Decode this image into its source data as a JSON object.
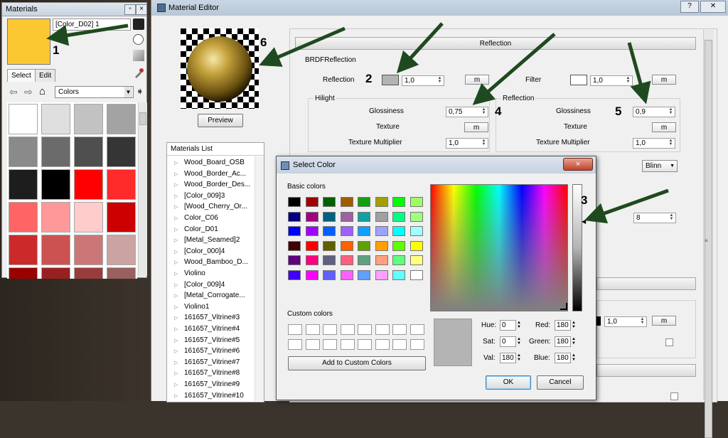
{
  "materials_panel": {
    "title": "Materials",
    "material_name": "[Color_D02] 1",
    "swatch_color": "#fcc831",
    "tabs": [
      "Select",
      "Edit"
    ],
    "library": "Colors",
    "colors": [
      "#ffffff",
      "#dfdfdf",
      "#c2c2c2",
      "#a3a3a3",
      "#8a8a8a",
      "#6b6b6b",
      "#4f4f4f",
      "#353535",
      "#1d1d1d",
      "#000000",
      "#ff0000",
      "#ff2a2a",
      "#ff6565",
      "#ff9999",
      "#ffcccc",
      "#cc0000",
      "#cc2a2a",
      "#cc5151",
      "#cc7777",
      "#cca3a3",
      "#990000",
      "#992020",
      "#993c3c",
      "#996060"
    ]
  },
  "editor": {
    "title": "Material Editor",
    "preview_button": "Preview",
    "reflection_section": "Reflection",
    "brdf_label": "BRDFReflection",
    "reflection_label": "Reflection",
    "reflection_value": "1,0",
    "m_label": "m",
    "filter_label": "Filter",
    "filter_value": "1,0",
    "hilight_group": "Hilight",
    "hilight_glossiness_label": "Glossiness",
    "hilight_glossiness_value": "0,75",
    "texture_label": "Texture",
    "texture_multiplier_label": "Texture Multiplier",
    "hilight_tex_mult_value": "1,0",
    "refl_group": "Reflection",
    "refl_glossiness_label": "Glossiness",
    "refl_glossiness_value": "0,9",
    "refl_tex_mult_value": "1,0",
    "blinn_label": "Blinn",
    "subdivs_value": "8",
    "lower_value": "1,0",
    "close_glyph": "✕",
    "help_glyph": "?",
    "callouts": [
      "1",
      "2",
      "3",
      "4",
      "5",
      "6"
    ]
  },
  "materials_list": {
    "title": "Materials List",
    "items": [
      "Wood_Board_OSB",
      "Wood_Border_Ac...",
      "Wood_Border_Des...",
      "[Color_009]3",
      "[Wood_Cherry_Or...",
      "Color_C06",
      "Color_D01",
      "[Metal_Seamed]2",
      "[Color_000]4",
      "Wood_Bamboo_D...",
      "Violino",
      "[Color_009]4",
      "[Metal_Corrogate...",
      "Violino1",
      "161657_Vitrine#3",
      "161657_Vitrine#4",
      "161657_Vitrine#5",
      "161657_Vitrine#6",
      "161657_Vitrine#7",
      "161657_Vitrine#8",
      "161657_Vitrine#9",
      "161657_Vitrine#10"
    ]
  },
  "select_color": {
    "title": "Select Color",
    "basic_colors_label": "Basic colors",
    "basic_colors": [
      "#000000",
      "#a00000",
      "#006000",
      "#a05c00",
      "#10a010",
      "#a0a000",
      "#00ff00",
      "#a0ff60",
      "#000080",
      "#a00080",
      "#006080",
      "#a060a0",
      "#10a0a0",
      "#a0a0a0",
      "#00ff80",
      "#a0ff80",
      "#0000ff",
      "#a000ff",
      "#0060ff",
      "#a060ff",
      "#10a0ff",
      "#a0a0ff",
      "#00ffff",
      "#a0ffff",
      "#400000",
      "#ff0000",
      "#606000",
      "#ff6000",
      "#60a000",
      "#ffa000",
      "#60ff00",
      "#ffff00",
      "#600080",
      "#ff0080",
      "#606080",
      "#ff6080",
      "#60a080",
      "#ffa080",
      "#60ff80",
      "#ffff80",
      "#4000ff",
      "#ff00ff",
      "#6060ff",
      "#ff60ff",
      "#60a0ff",
      "#ffa0ff",
      "#60ffff",
      "#ffffff"
    ],
    "custom_colors_label": "Custom colors",
    "add_custom_button": "Add to Custom Colors",
    "hue_label": "Hue:",
    "hue_value": "0",
    "sat_label": "Sat:",
    "sat_value": "0",
    "val_label": "Val:",
    "val_value": "180",
    "red_label": "Red:",
    "red_value": "180",
    "green_label": "Green:",
    "green_value": "180",
    "blue_label": "Blue:",
    "blue_value": "180",
    "current_color": "#b4b4b4",
    "ok_button": "OK",
    "cancel_button": "Cancel"
  }
}
